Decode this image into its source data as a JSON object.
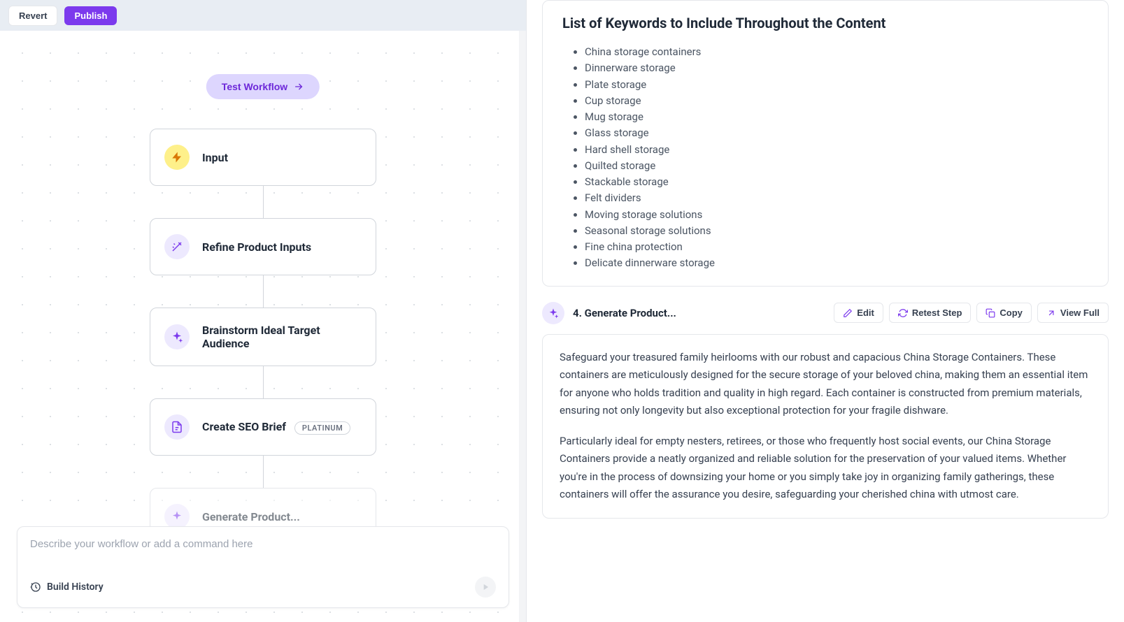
{
  "toolbar": {
    "revert": "Revert",
    "publish": "Publish"
  },
  "test_workflow": "Test Workflow",
  "nodes": {
    "input": "Input",
    "refine": "Refine Product Inputs",
    "brainstorm": "Brainstorm Ideal Target Audience",
    "seo": "Create SEO Brief",
    "seo_badge": "PLATINUM",
    "generate": "Generate Product..."
  },
  "cmd": {
    "placeholder": "Describe your workflow or add a command here",
    "build_history": "Build History"
  },
  "keywords": {
    "heading": "List of Keywords to Include Throughout the Content",
    "items": [
      "China storage containers",
      "Dinnerware storage",
      "Plate storage",
      "Cup storage",
      "Mug storage",
      "Glass storage",
      "Hard shell storage",
      "Quilted storage",
      "Stackable storage",
      "Felt dividers",
      "Moving storage solutions",
      "Seasonal storage solutions",
      "Fine china protection",
      "Delicate dinnerware storage"
    ]
  },
  "step4": {
    "title": "4. Generate Product...",
    "actions": {
      "edit": "Edit",
      "retest": "Retest Step",
      "copy": "Copy",
      "viewfull": "View Full"
    },
    "p1": "Safeguard your treasured family heirlooms with our robust and capacious China Storage Containers. These containers are meticulously designed for the secure storage of your beloved china, making them an essential item for anyone who holds tradition and quality in high regard. Each container is constructed from premium materials, ensuring not only longevity but also exceptional protection for your fragile dishware.",
    "p2": "Particularly ideal for empty nesters, retirees, or those who frequently host social events, our China Storage Containers provide a neatly organized and reliable solution for the preservation of your valued items. Whether you're in the process of downsizing your home or you simply take joy in organizing family gatherings, these containers will offer the assurance you desire, safeguarding your cherished china with utmost care."
  }
}
